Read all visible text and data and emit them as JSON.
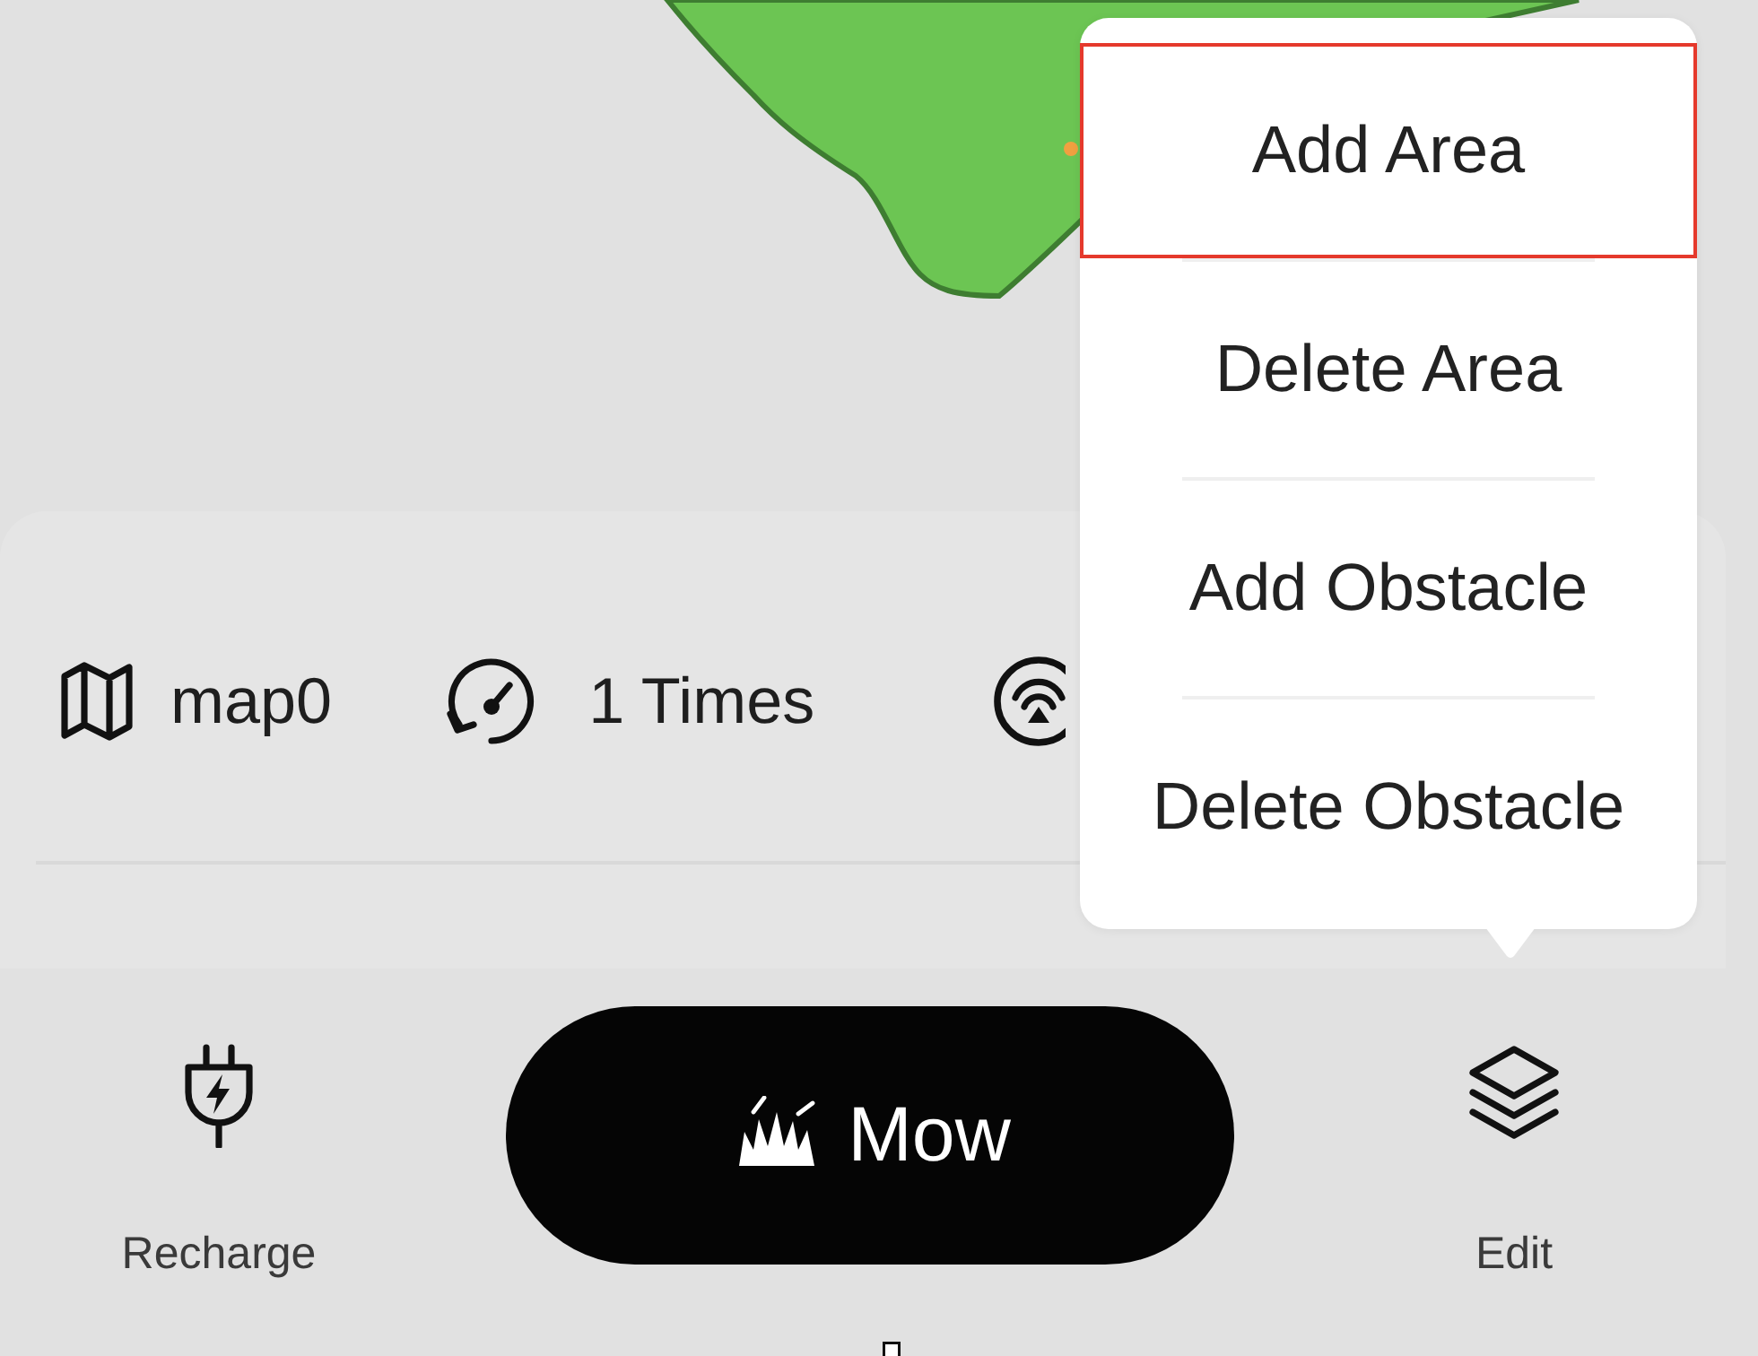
{
  "edit_menu": {
    "items": [
      {
        "label": "Add Area",
        "selected": true
      },
      {
        "label": "Delete Area",
        "selected": false
      },
      {
        "label": "Add Obstacle",
        "selected": false
      },
      {
        "label": "Delete Obstacle",
        "selected": false
      }
    ]
  },
  "info": [
    {
      "kind": "map",
      "text": "map0"
    },
    {
      "kind": "times",
      "text": "1 Times"
    },
    {
      "kind": "signal"
    }
  ],
  "actions": [
    {
      "kind": "recharge",
      "label": "Recharge"
    },
    {
      "kind": "mow",
      "label": "Mow"
    },
    {
      "kind": "edit",
      "label": "Edit"
    }
  ]
}
